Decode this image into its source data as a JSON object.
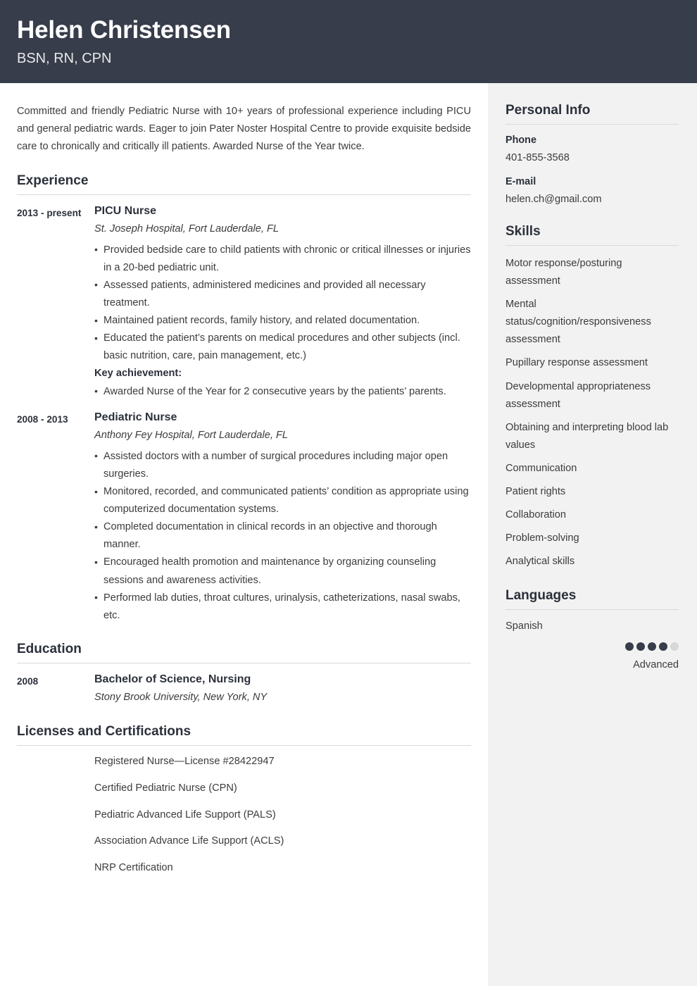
{
  "header": {
    "name": "Helen Christensen",
    "credentials": "BSN, RN, CPN",
    "bg_color": "#373d4a"
  },
  "summary": "Committed and friendly Pediatric Nurse with 10+ years of professional experience including PICU and general pediatric wards. Eager to join Pater Noster Hospital Centre to provide exquisite bedside care to chronically and critically ill patients. Awarded Nurse of the Year twice.",
  "sections": {
    "experience_title": "Experience",
    "education_title": "Education",
    "licenses_title": "Licenses and Certifications"
  },
  "experience": [
    {
      "date": "2013 - present",
      "title": "PICU Nurse",
      "org": "St. Joseph Hospital, Fort Lauderdale, FL",
      "bullets": [
        "Provided bedside care to child patients with chronic or critical illnesses or injuries in a 20-bed pediatric unit.",
        "Assessed patients, administered medicines and provided all necessary treatment.",
        "Maintained patient records, family history, and related documentation.",
        "Educated the patient’s parents on medical procedures and other subjects (incl. basic nutrition, care, pain management, etc.)"
      ],
      "key_achievement_label": "Key achievement:",
      "achievements": [
        "Awarded Nurse of the Year for 2 consecutive years by the patients’ parents."
      ]
    },
    {
      "date": "2008 - 2013",
      "title": "Pediatric Nurse",
      "org": "Anthony Fey Hospital, Fort Lauderdale, FL",
      "bullets": [
        "Assisted doctors with a number of surgical procedures including major open surgeries.",
        "Monitored, recorded, and communicated patients’ condition as appropriate using computerized documentation systems.",
        "Completed documentation in clinical records in an objective and thorough manner.",
        "Encouraged health promotion and maintenance by organizing counseling sessions and awareness activities.",
        "Performed lab duties, throat cultures, urinalysis, catheterizations, nasal swabs, etc."
      ],
      "key_achievement_label": "",
      "achievements": []
    }
  ],
  "education": [
    {
      "date": "2008",
      "title": "Bachelor of Science, Nursing",
      "org": "Stony Brook University, New York, NY"
    }
  ],
  "licenses": [
    "Registered Nurse—License #28422947",
    "Certified Pediatric Nurse (CPN)",
    "Pediatric Advanced Life Support (PALS)",
    "Association Advance Life Support (ACLS)",
    "NRP Certification"
  ],
  "sidebar": {
    "personal_info_title": "Personal Info",
    "phone_label": "Phone",
    "phone_value": "401-855-3568",
    "email_label": "E-mail",
    "email_value": "helen.ch@gmail.com",
    "skills_title": "Skills",
    "skills": [
      "Motor response/posturing assessment",
      "Mental status/cognition/responsiveness assessment",
      "Pupillary response assessment",
      "Developmental appropriateness assessment",
      "Obtaining and interpreting blood lab values",
      "Communication",
      "Patient rights",
      "Collaboration",
      "Problem-solving",
      "Analytical skills"
    ],
    "languages_title": "Languages",
    "languages": [
      {
        "name": "Spanish",
        "level": "Advanced",
        "filled": 4,
        "total": 5
      }
    ],
    "bg_color": "#f2f2f2",
    "dot_color": "#373d4a",
    "dot_empty_color": "#d8d8d8"
  }
}
